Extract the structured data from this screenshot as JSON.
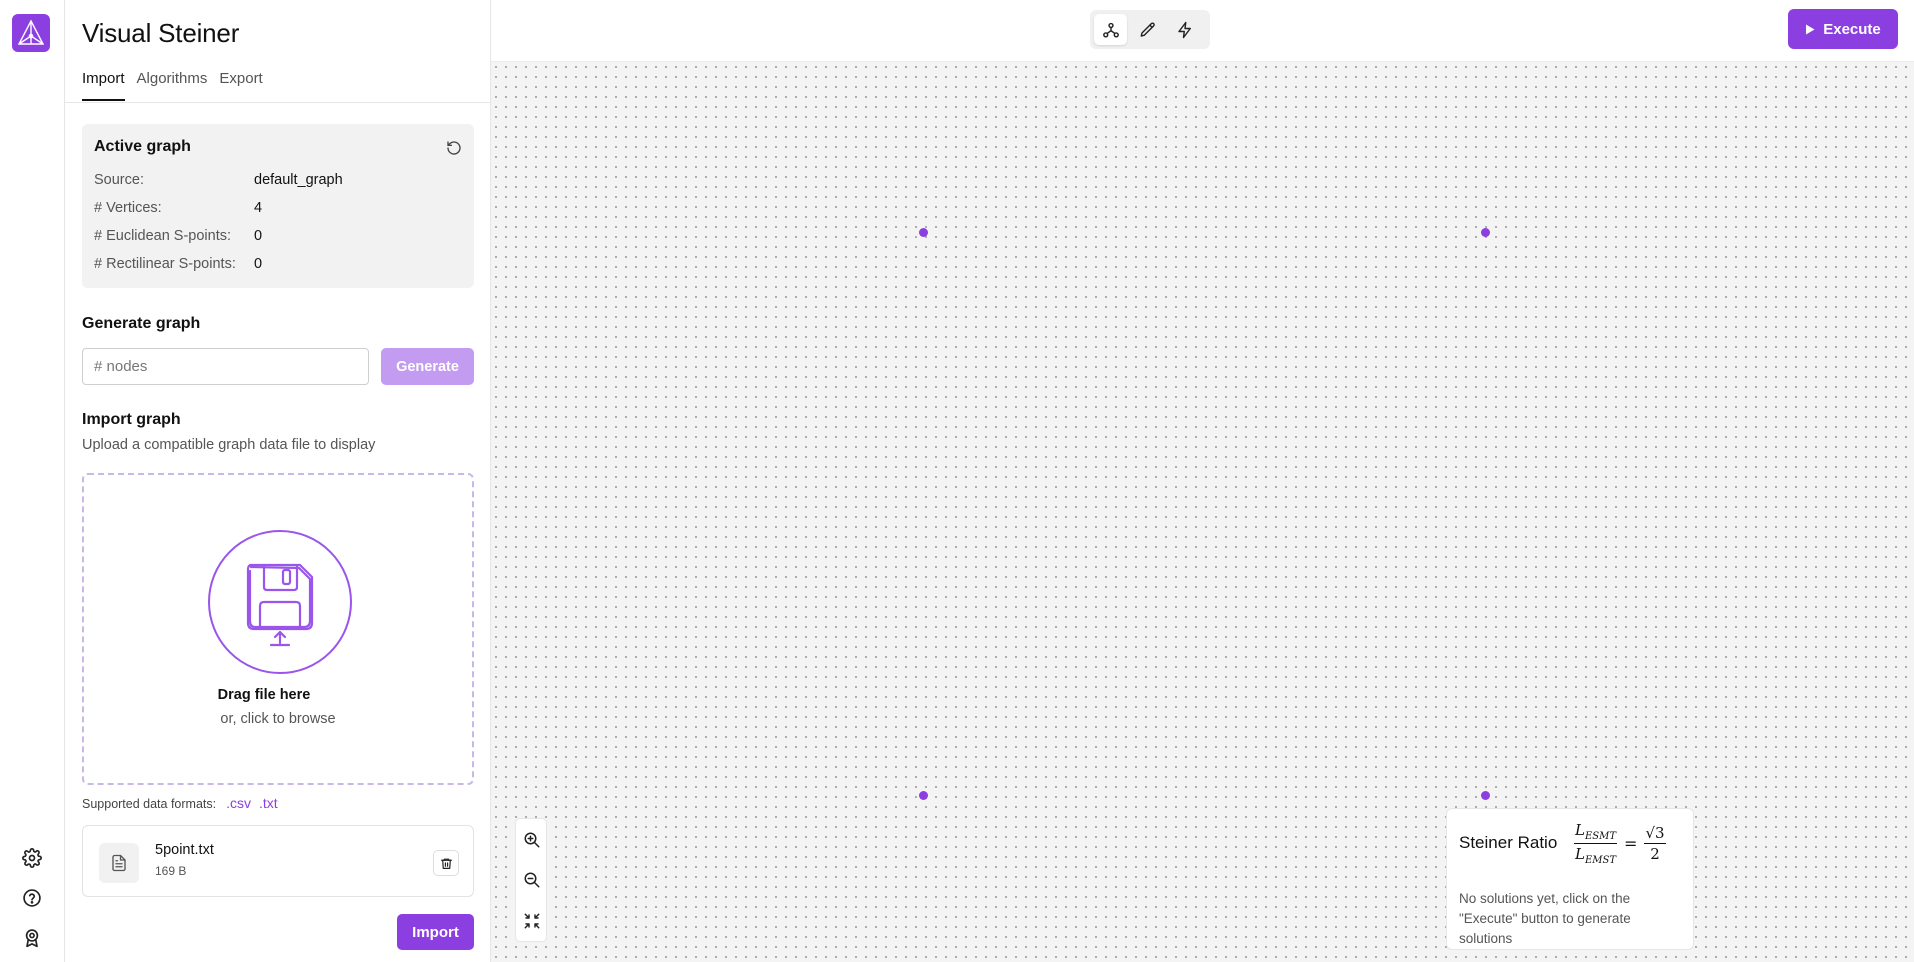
{
  "app": {
    "title": "Visual Steiner"
  },
  "tabs": [
    {
      "label": "Import"
    },
    {
      "label": "Algorithms"
    },
    {
      "label": "Export"
    }
  ],
  "active_graph": {
    "title": "Active graph",
    "rows": [
      {
        "label": "Source:",
        "value": "default_graph"
      },
      {
        "label": "# Vertices:",
        "value": "4"
      },
      {
        "label": "# Euclidean S-points:",
        "value": "0"
      },
      {
        "label": "# Rectilinear S-points:",
        "value": "0"
      }
    ]
  },
  "generate": {
    "title": "Generate graph",
    "input_placeholder": "# nodes",
    "input_value": "",
    "button_label": "Generate"
  },
  "import_graph": {
    "title": "Import graph",
    "subtitle": "Upload a compatible graph data file to display",
    "drop_title": "Drag file here",
    "drop_sub": "or, click to browse",
    "formats_label": "Supported data formats:",
    "formats": [
      ".csv",
      ".txt"
    ],
    "file": {
      "name": "5point.txt",
      "size": "169 B"
    },
    "button_label": "Import"
  },
  "toolbar": {
    "tools": [
      "graph-nodes-icon",
      "pencil-icon",
      "lightning-icon"
    ],
    "active_tool": 0,
    "execute_label": "Execute"
  },
  "ratio": {
    "title": "Steiner Ratio",
    "num_sym": "L",
    "num_sub": "ESMT",
    "den_sym": "L",
    "den_sub": "EMST",
    "eq": "=",
    "rhs_num": "√3",
    "rhs_den": "2",
    "message": "No solutions yet, click on the \"Execute\" button to generate solutions"
  },
  "colors": {
    "accent": "#8b3fe0",
    "accent_disabled": "#c39cf1",
    "canvas_bg": "#f4f4f4"
  }
}
